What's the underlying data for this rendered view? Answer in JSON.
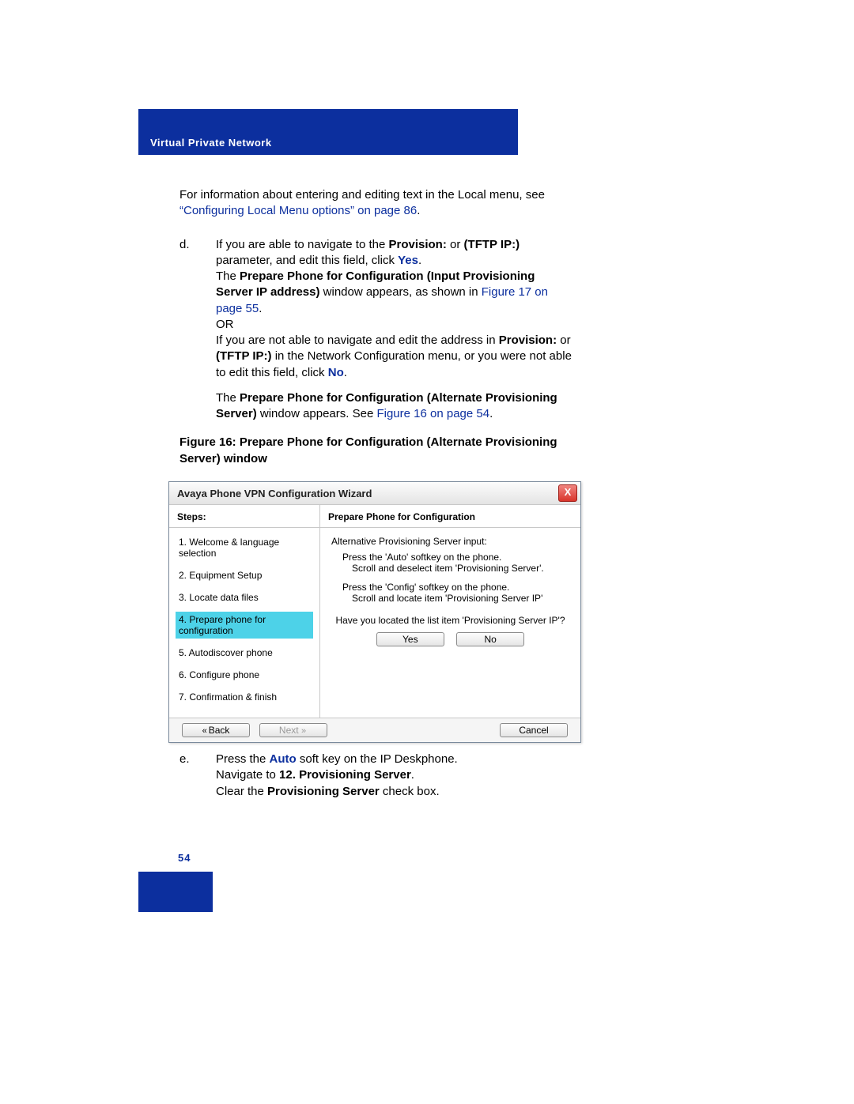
{
  "header": {
    "section_title": "Virtual Private Network"
  },
  "intro": {
    "text": "For information about entering and editing text in the Local menu, see ",
    "link": "“Configuring Local Menu options” on page 86",
    "dot": "."
  },
  "step_d": {
    "marker": "d.",
    "p1a": "If you are able to navigate to the ",
    "p1b": "Provision:",
    "p1c": " or ",
    "p1d": "(TFTP IP:)",
    "p1e": " parameter, and edit this field, click ",
    "p1f": "Yes",
    "p1g": ".",
    "p2a": "The ",
    "p2b": "Prepare Phone for Configuration (Input Provisioning Server IP address)",
    "p2c": " window appears, as shown in ",
    "p2d": "Figure 17 on page 55",
    "p2e": ".",
    "or": "OR",
    "p3a": "If you are not able to navigate and edit the address in ",
    "p3b": "Provision:",
    "p3c": " or ",
    "p3d": "(TFTP IP:)",
    "p3e": " in the Network Configuration menu, or you were not able to edit this field, click ",
    "p3f": "No",
    "p3g": ".",
    "p4a": "The ",
    "p4b": "Prepare Phone for Configuration (Alternate Provisioning Server)",
    "p4c": " window appears. See ",
    "p4d": "Figure 16 on page 54",
    "p4e": "."
  },
  "figure_caption": "Figure 16: Prepare Phone for Configuration (Alternate Provisioning Server) window",
  "wizard": {
    "title": "Avaya Phone VPN Configuration Wizard",
    "close": "X",
    "steps_header": "Steps:",
    "right_header": "Prepare Phone for Configuration",
    "steps": [
      "1. Welcome & language selection",
      "2. Equipment Setup",
      "3. Locate data files",
      "4. Prepare phone for configuration",
      "5. Autodiscover phone",
      "6. Configure phone",
      "7. Confirmation & finish"
    ],
    "content": {
      "line1": "Alternative Provisioning Server input:",
      "line2": "Press the 'Auto' softkey on the phone.",
      "line3": "Scroll and deselect item 'Provisioning Server'.",
      "line4": "Press the 'Config' softkey on the phone.",
      "line5": "Scroll and locate item 'Provisioning Server IP'",
      "question": "Have you located the list item 'Provisioning Server IP'?",
      "yes": "Yes",
      "no": "No"
    },
    "footer": {
      "back": "Back",
      "next": "Next",
      "cancel": "Cancel"
    }
  },
  "step_e": {
    "marker": "e.",
    "p1a": "Press the ",
    "p1b": "Auto",
    "p1c": " soft key on the IP Deskphone.",
    "p2a": "Navigate to ",
    "p2b": "12. Provisioning Server",
    "p2c": ".",
    "p3a": "Clear the ",
    "p3b": "Provisioning Server",
    "p3c": " check box."
  },
  "page_number": "54"
}
